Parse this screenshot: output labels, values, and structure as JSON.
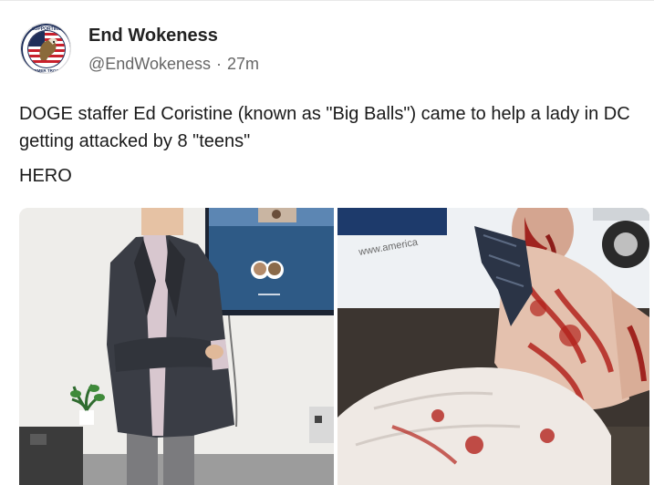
{
  "post": {
    "display_name": "End Wokeness",
    "handle": "@EndWokeness",
    "separator": "·",
    "time": "27m",
    "text": "DOGE staffer Ed Coristine (known as \"Big Balls\") came to help a lady in DC getting attacked by 8 \"teens\"",
    "text2": "HERO"
  },
  "avatar": {
    "icon": "eagle-logo-icon",
    "ring_text_top": "SUPPORTING",
    "ring_text_bottom": "FORMER TROOPS"
  },
  "media": {
    "left_image": "man-in-suit-photo",
    "right_image": "injured-man-photo",
    "van_text": "www.america"
  },
  "colors": {
    "text": "#1a1a1a",
    "muted": "#666666",
    "border": "#e8e8e8"
  }
}
